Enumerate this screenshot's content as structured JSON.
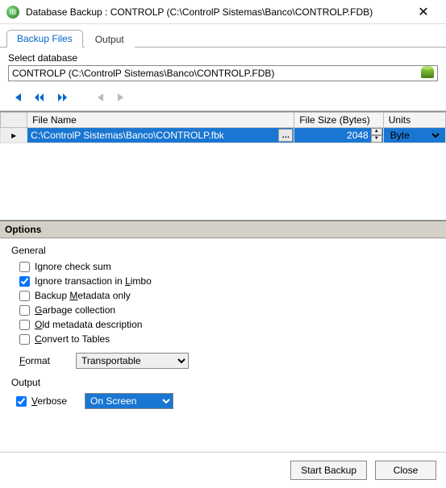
{
  "title": "Database Backup : CONTROLP (C:\\ControlP Sistemas\\Banco\\CONTROLP.FDB)",
  "tabs": {
    "backup": "Backup Files",
    "output": "Output"
  },
  "selectdb": {
    "label": "Select database",
    "value": "CONTROLP (C:\\ControlP Sistemas\\Banco\\CONTROLP.FDB)"
  },
  "grid": {
    "col_file": "File Name",
    "col_size": "File Size (Bytes)",
    "col_units": "Units",
    "row": {
      "file": "C:\\ControlP Sistemas\\Banco\\CONTROLP.fbk",
      "size": "2048",
      "units_selected": "Byte",
      "units_options": [
        "Byte"
      ]
    }
  },
  "options_header": "Options",
  "general_label": "General",
  "checks": {
    "ignore_sum": {
      "label": "Ignore check sum",
      "checked": false
    },
    "ignore_limbo": {
      "label_pre": "Ignore transaction in ",
      "label_und": "L",
      "label_post": "imbo",
      "checked": true
    },
    "metadata_only": {
      "label_pre": "Backup ",
      "label_und": "M",
      "label_post": "etadata only",
      "checked": false
    },
    "garbage": {
      "label_und": "G",
      "label_post": "arbage collection",
      "checked": false
    },
    "old_meta": {
      "label_und": "O",
      "label_post": "ld metadata description",
      "checked": false
    },
    "convert": {
      "label_und": "C",
      "label_post": "onvert to Tables",
      "checked": false
    }
  },
  "format": {
    "label_und": "F",
    "label_post": "ormat",
    "selected": "Transportable",
    "options": [
      "Transportable"
    ]
  },
  "output_label": "Output",
  "verbose": {
    "label_und": "V",
    "label_post": "erbose",
    "checked": true,
    "selected": "On Screen",
    "options": [
      "On Screen"
    ]
  },
  "buttons": {
    "start": "Start Backup",
    "close": "Close"
  }
}
